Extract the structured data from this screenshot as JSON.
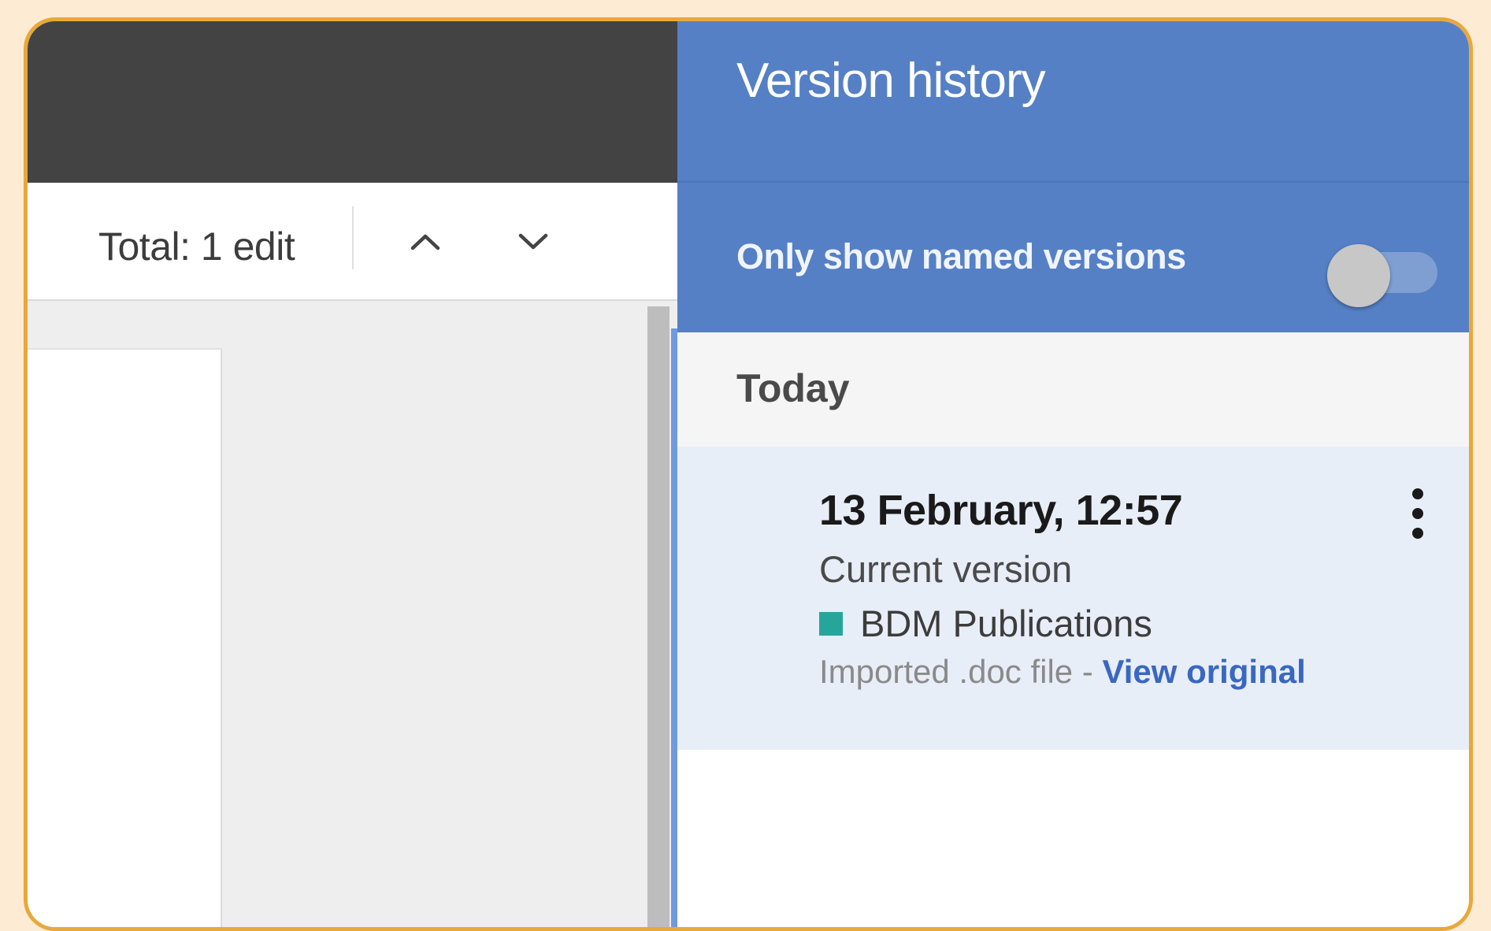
{
  "toolbar": {
    "total_edits": "Total: 1 edit",
    "prev_icon": "chevron-up-icon",
    "next_icon": "chevron-down-icon"
  },
  "version_history": {
    "title": "Version history",
    "filter_label": "Only show named versions",
    "filter_enabled": false,
    "groups": [
      {
        "label": "Today",
        "versions": [
          {
            "date": "13 February, 12:57",
            "status": "Current version",
            "author": "BDM Publications",
            "author_color": "#26a69a",
            "note": "Imported .doc file - ",
            "link": "View original",
            "menu_icon": "more-vert-icon"
          }
        ]
      }
    ]
  },
  "colors": {
    "panel_header": "#5580c5",
    "doc_topbar": "#434343",
    "selected_item": "#e8eef8",
    "link": "#3a67c0",
    "frame_border": "#e8a83a",
    "background": "#fdebd3"
  }
}
